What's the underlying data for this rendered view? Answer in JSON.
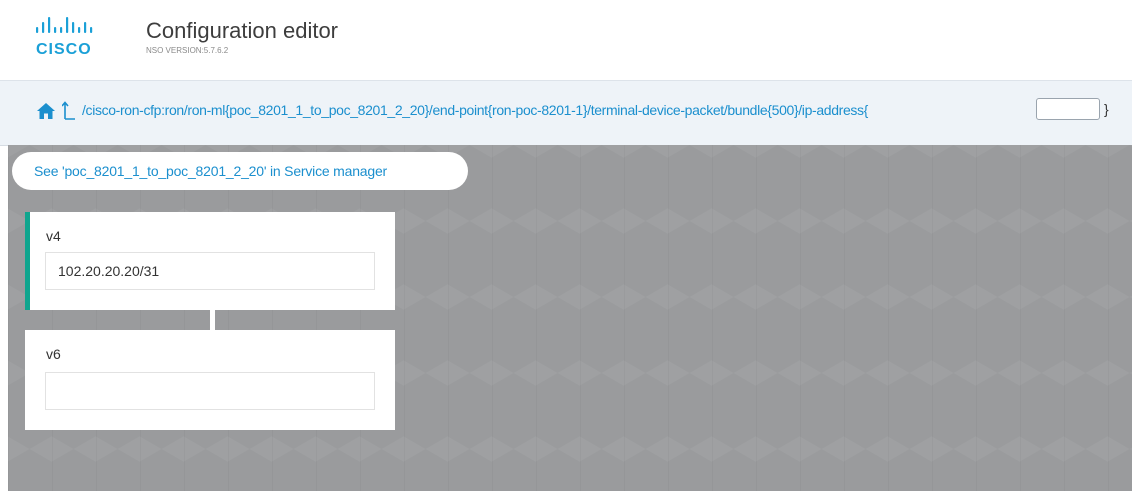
{
  "header": {
    "brand": "CISCO",
    "title": "Configuration editor",
    "version": "NSO VERSION:5.7.6.2"
  },
  "path_bar": {
    "path": "/cisco-ron-cfp:ron/ron-ml{poc_8201_1_to_poc_8201_2_20}/end-point{ron-poc-8201-1}/terminal-device-packet/bundle{500}/ip-address{",
    "key_value": "",
    "closing_brace": "}",
    "icons": [
      "home-icon",
      "up-arrow-icon"
    ]
  },
  "service_link": "See 'poc_8201_1_to_poc_8201_2_20' in Service manager",
  "leaves": [
    {
      "label": "v4",
      "value": "102.20.20.20/31",
      "selected": true
    },
    {
      "label": "v6",
      "value": "",
      "selected": false
    }
  ],
  "colors": {
    "link": "#1b8fce",
    "brand": "#1ba0d7",
    "selected": "#10a58e",
    "canvas": "#9a9b9d"
  }
}
